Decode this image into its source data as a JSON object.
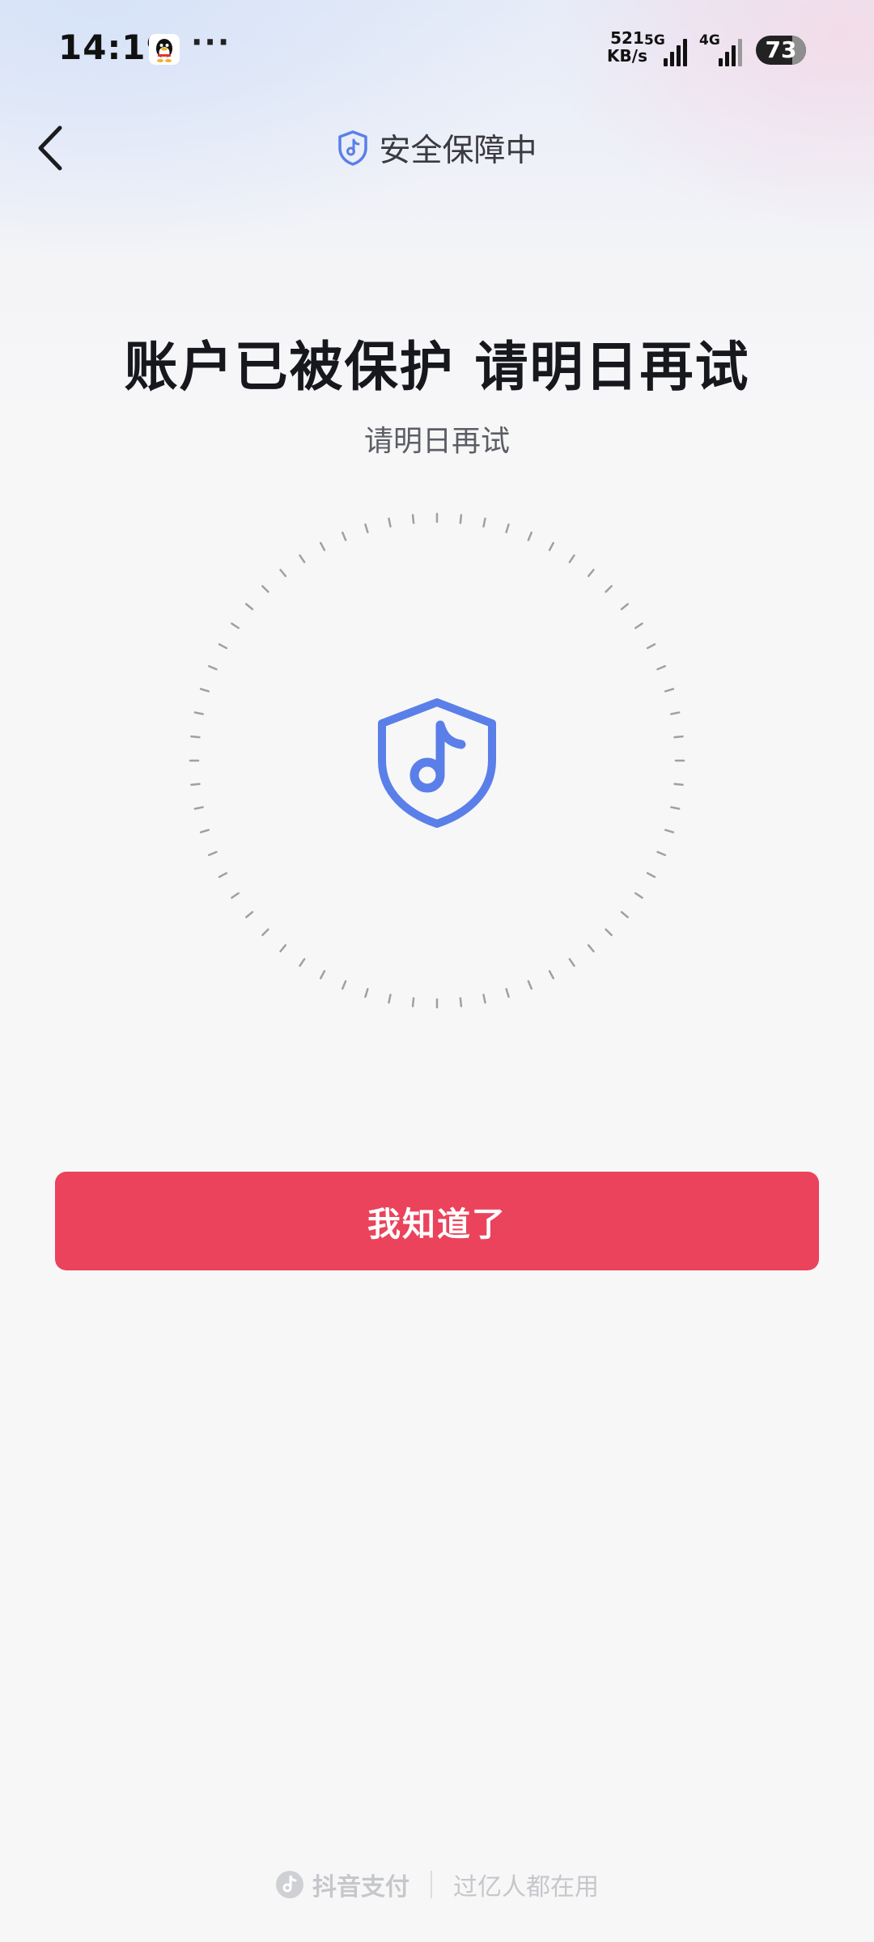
{
  "status_bar": {
    "time": "14:19",
    "more_dots": "···",
    "net_speed_value": "521",
    "net_speed_unit": "KB/s",
    "network_1": "5G",
    "network_2": "4G",
    "battery_level": "73"
  },
  "header": {
    "title": "安全保障中",
    "back_icon": "chevron-left-icon",
    "shield_icon": "douyin-shield-icon",
    "shield_color": "#5b7fe8"
  },
  "main": {
    "title": "账户已被保护 请明日再试",
    "subtitle": "请明日再试",
    "center_icon": "douyin-shield-icon",
    "icon_color": "#5b7fe8"
  },
  "action": {
    "confirm_label": "我知道了",
    "button_color": "#ea435b"
  },
  "footer": {
    "brand": "抖音支付",
    "slogan": "过亿人都在用"
  }
}
